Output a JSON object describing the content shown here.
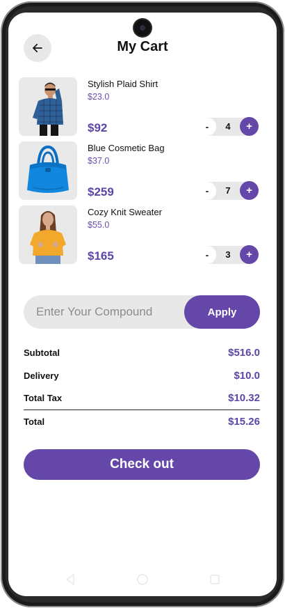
{
  "header": {
    "title": "My Cart",
    "back_icon": "arrow-left-icon"
  },
  "cart": {
    "items": [
      {
        "name": "Stylish Plaid Shirt",
        "unit_price": "$23.0",
        "total": "$92",
        "qty": "4",
        "minus": "-",
        "plus": "+"
      },
      {
        "name": "Blue Cosmetic Bag",
        "unit_price": "$37.0",
        "total": "$259",
        "qty": "7",
        "minus": "-",
        "plus": "+"
      },
      {
        "name": "Cozy Knit Sweater",
        "unit_price": "$55.0",
        "total": "$165",
        "qty": "3",
        "minus": "-",
        "plus": "+"
      }
    ]
  },
  "coupon": {
    "placeholder": "Enter Your Compound",
    "value": "",
    "apply_label": "Apply"
  },
  "summary": {
    "subtotal_label": "Subtotal",
    "subtotal_value": "$516.0",
    "delivery_label": "Delivery",
    "delivery_value": "$10.0",
    "tax_label": "Total Tax",
    "tax_value": "$10.32",
    "total_label": "Total",
    "total_value": "$15.26"
  },
  "checkout": {
    "label": "Check out"
  },
  "colors": {
    "accent": "#6447a8",
    "price_text": "#5b45a6",
    "field_bg": "#e8e8e8"
  }
}
